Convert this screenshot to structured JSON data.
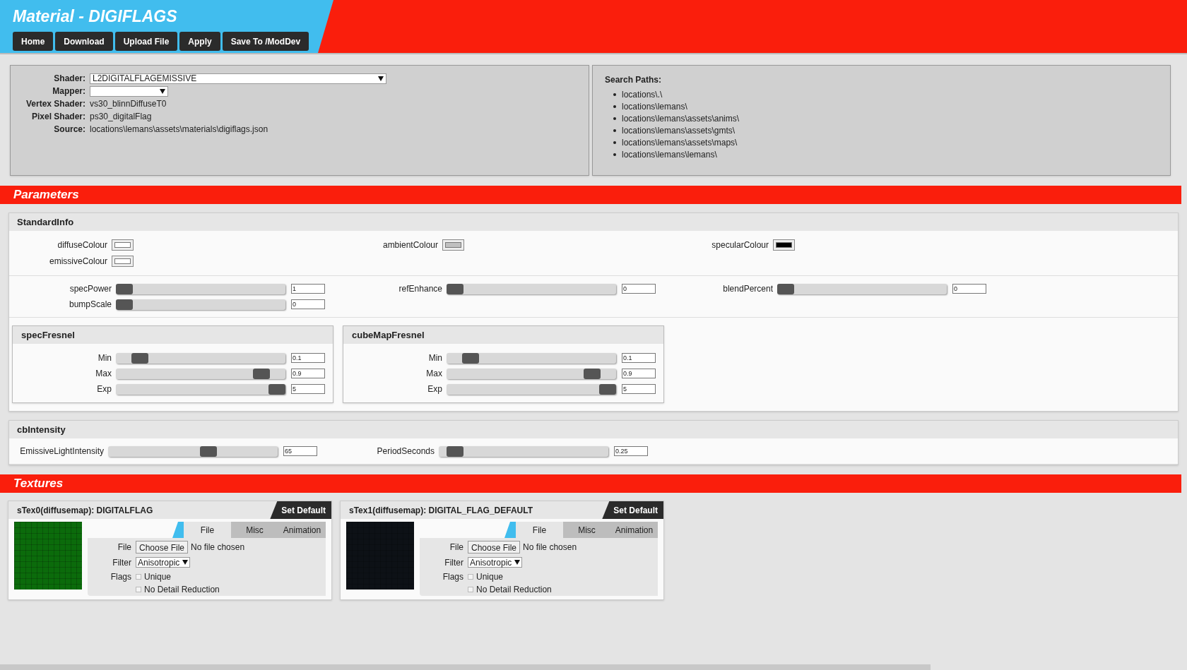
{
  "header": {
    "title": "Material - DIGIFLAGS",
    "buttons": [
      "Home",
      "Download",
      "Upload File",
      "Apply",
      "Save To /ModDev"
    ]
  },
  "info": {
    "fields": [
      {
        "label": "Shader:",
        "kind": "select",
        "value": "L2DIGITALFLAGEMISSIVE"
      },
      {
        "label": "Mapper:",
        "kind": "select"
      },
      {
        "label": "Vertex Shader:",
        "kind": "text",
        "value": "vs30_blinnDiffuseT0"
      },
      {
        "label": "Pixel Shader:",
        "kind": "text",
        "value": "ps30_digitalFlag"
      },
      {
        "label": "Source:",
        "kind": "text",
        "value": "locations\\lemans\\assets\\materials\\digiflags.json"
      }
    ],
    "search_paths": {
      "title": "Search Paths:",
      "items": [
        "locations\\.\\",
        "locations\\lemans\\",
        "locations\\lemans\\assets\\anims\\",
        "locations\\lemans\\assets\\gmts\\",
        "locations\\lemans\\assets\\maps\\",
        "locations\\lemans\\lemans\\"
      ]
    }
  },
  "parameters": {
    "title": "Parameters",
    "groups": [
      {
        "title": "StandardInfo",
        "colours": [
          [
            {
              "label": "diffuseColour",
              "color": "#ffffff"
            },
            {
              "label": "emissiveColour",
              "color": "#ffffff"
            }
          ],
          [
            {
              "label": "ambientColour",
              "color": "#c0c0c0"
            }
          ],
          [
            {
              "label": "specularColour",
              "color": "#000000"
            }
          ]
        ],
        "sliders": [
          [
            {
              "label": "specPower",
              "level": 0,
              "value": "1"
            },
            {
              "label": "bumpScale",
              "level": 0,
              "value": "0"
            }
          ],
          [
            {
              "label": "refEnhance",
              "level": 0,
              "value": "0"
            }
          ],
          [
            {
              "label": "blendPercent",
              "level": 0,
              "value": "0"
            }
          ]
        ],
        "subgroups": [
          {
            "title": "specFresnel",
            "sliders": [
              {
                "label": "Min",
                "level": 0.1,
                "value": "0.1"
              },
              {
                "label": "Max",
                "level": 0.9,
                "value": "0.9"
              },
              {
                "label": "Exp",
                "level": 1,
                "value": "5"
              }
            ]
          },
          {
            "title": "cubeMapFresnel",
            "sliders": [
              {
                "label": "Min",
                "level": 0.1,
                "value": "0.1"
              },
              {
                "label": "Max",
                "level": 0.9,
                "value": "0.9"
              },
              {
                "label": "Exp",
                "level": 1,
                "value": "5"
              }
            ]
          }
        ]
      },
      {
        "title": "cbIntensity",
        "sliders": [
          [
            {
              "label": "EmissiveLightIntensity",
              "level": 0.6,
              "value": "65"
            }
          ],
          [
            {
              "label": "PeriodSeconds",
              "level": 0.05,
              "value": "0.25"
            }
          ]
        ]
      }
    ]
  },
  "textures": {
    "title": "Textures",
    "items": [
      {
        "title": "sTex0(diffusemap): DIGITALFLAG",
        "button": "Set Default",
        "color": "#0b6b0b",
        "tabs": [
          {
            "label": "File",
            "selected": true
          },
          {
            "label": "Misc",
            "selected": false
          },
          {
            "label": "Animation",
            "selected": false
          }
        ],
        "file_label": "File",
        "file_button": "Choose File",
        "file_status": "No file chosen",
        "filter_label": "Filter",
        "filter_value": "Anisotropic",
        "flags_label": "Flags",
        "flags": [
          {
            "label": "Unique",
            "checked": false
          },
          {
            "label": "No Detail Reduction",
            "checked": false
          }
        ]
      },
      {
        "title": "sTex1(diffusemap): DIGITAL_FLAG_DEFAULT",
        "button": "Set Default",
        "color": "#0d1116",
        "tabs": [
          {
            "label": "File",
            "selected": true
          },
          {
            "label": "Misc",
            "selected": false
          },
          {
            "label": "Animation",
            "selected": false
          }
        ],
        "file_label": "File",
        "file_button": "Choose File",
        "file_status": "No file chosen",
        "filter_label": "Filter",
        "filter_value": "Anisotropic",
        "flags_label": "Flags",
        "flags": [
          {
            "label": "Unique",
            "checked": false
          },
          {
            "label": "No Detail Reduction",
            "checked": false
          }
        ]
      }
    ]
  }
}
